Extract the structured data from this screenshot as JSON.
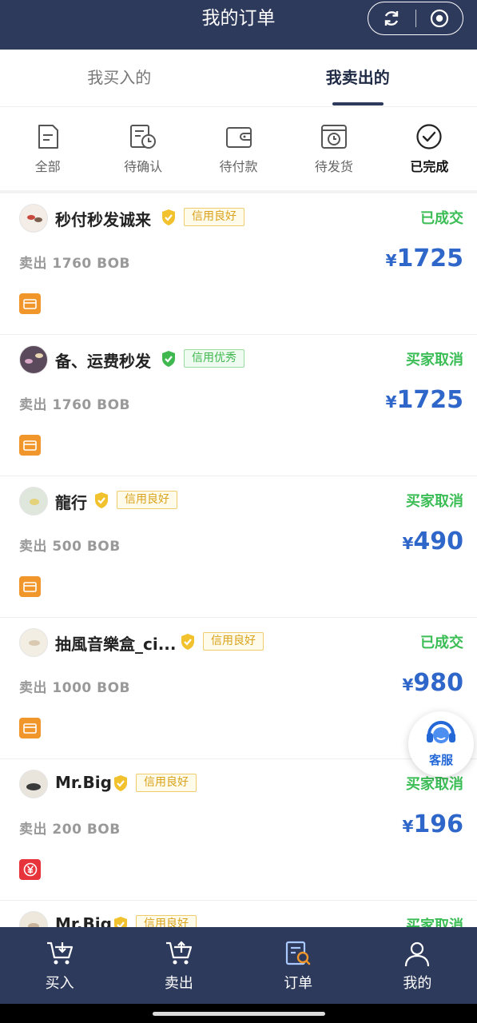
{
  "header": {
    "title": "我的订单"
  },
  "tabs": [
    {
      "label": "我买入的",
      "active": false
    },
    {
      "label": "我卖出的",
      "active": true
    }
  ],
  "filters": [
    {
      "label": "全部",
      "icon": "document-icon",
      "active": false
    },
    {
      "label": "待确认",
      "icon": "clock-list-icon",
      "active": false
    },
    {
      "label": "待付款",
      "icon": "wallet-icon",
      "active": false
    },
    {
      "label": "待发货",
      "icon": "box-clock-icon",
      "active": false
    },
    {
      "label": "已完成",
      "icon": "check-circle-icon",
      "active": true
    }
  ],
  "orders": [
    {
      "seller": "秒付秒发诚来",
      "credit": "信用良好",
      "credit_level": "good",
      "status": "已成交",
      "sold": "卖出 1760 BOB",
      "currency": "¥",
      "price": "1725",
      "payment_icon": "card-icon"
    },
    {
      "seller": "备、运费秒发",
      "credit": "信用优秀",
      "credit_level": "great",
      "status": "买家取消",
      "sold": "卖出 1760 BOB",
      "currency": "¥",
      "price": "1725",
      "payment_icon": "card-icon"
    },
    {
      "seller": "龍行",
      "credit": "信用良好",
      "credit_level": "good",
      "status": "买家取消",
      "sold": "卖出 500 BOB",
      "currency": "¥",
      "price": "490",
      "payment_icon": "card-icon"
    },
    {
      "seller": "抽風音樂盒_ci...",
      "credit": "信用良好",
      "credit_level": "good",
      "status": "已成交",
      "sold": "卖出 1000 BOB",
      "currency": "¥",
      "price": "980",
      "payment_icon": "card-icon"
    },
    {
      "seller": "Mr.Big",
      "credit": "信用良好",
      "credit_level": "good",
      "status": "买家取消",
      "sold": "卖出 200 BOB",
      "currency": "¥",
      "price": "196",
      "payment_icon": "yuan-icon"
    },
    {
      "seller": "Mr.Big",
      "credit": "信用良好",
      "credit_level": "good",
      "status": "买家取消",
      "sold": "",
      "currency": "",
      "price": "",
      "payment_icon": ""
    }
  ],
  "customer_service": {
    "label": "客服"
  },
  "bottom_nav": [
    {
      "label": "买入",
      "icon": "cart-down-icon"
    },
    {
      "label": "卖出",
      "icon": "cart-up-icon"
    },
    {
      "label": "订单",
      "icon": "order-search-icon"
    },
    {
      "label": "我的",
      "icon": "user-icon"
    }
  ],
  "colors": {
    "header_bg": "#2e3a5c",
    "price_blue": "#2f66c9",
    "status_green": "#3bbd55",
    "credit_good": "#d9a21a",
    "credit_great": "#3fb94f"
  }
}
